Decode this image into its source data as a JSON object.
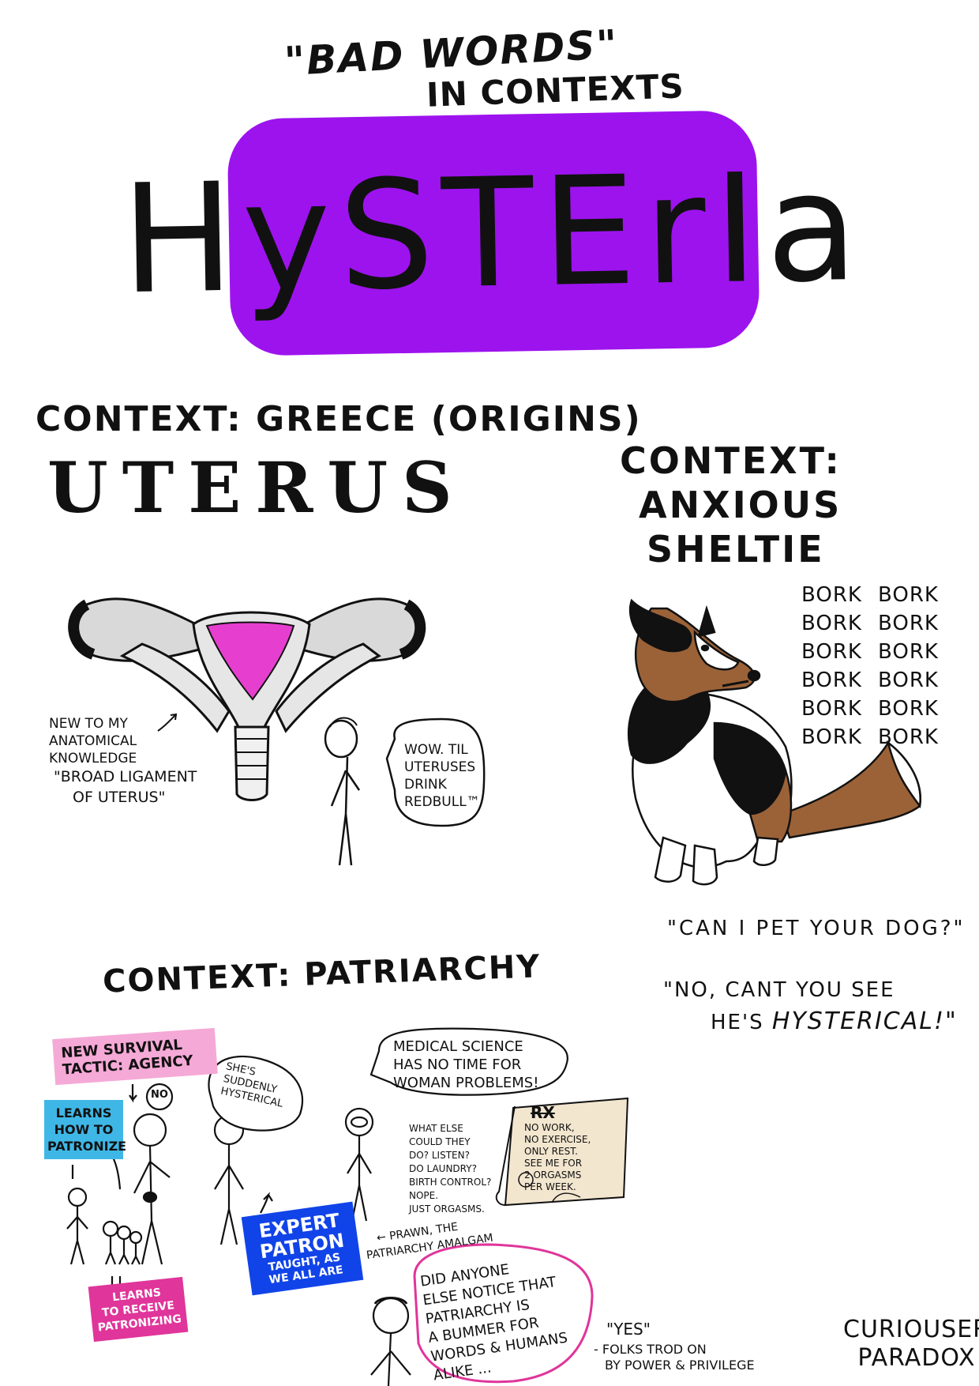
{
  "header": {
    "title_line1": "\"BAD WORDS\"",
    "title_line2": "IN CONTEXTS",
    "banner_word": "HySTErIa",
    "banner_color": "#9d13ee"
  },
  "greece": {
    "heading": "CONTEXT: GREECE (ORIGINS)",
    "word": "UTERUS",
    "note_new_knowledge": [
      "NEW TO MY",
      "ANATOMICAL",
      "KNOWLEDGE"
    ],
    "note_ligament": [
      "\"BROAD LIGAMENT",
      "OF UTERUS\""
    ],
    "speech": [
      "WOW. TIL",
      "UTERUSES",
      "DRINK",
      "REDBULL™"
    ],
    "uterus_color": "#e63fcf"
  },
  "sheltie": {
    "heading": [
      "CONTEXT:",
      "ANXIOUS",
      "SHELTIE"
    ],
    "bork_rows": [
      [
        "BORK",
        "BORK"
      ],
      [
        "BORK",
        "BORK"
      ],
      [
        "BORK",
        "BORK"
      ],
      [
        "BORK",
        "BORK"
      ],
      [
        "BORK",
        "BORK"
      ],
      [
        "BORK",
        "BORK"
      ]
    ],
    "quote_question": "\"CAN I PET YOUR DOG?\"",
    "quote_answer_1": "\"NO, CANT YOU SEE",
    "quote_answer_2_prefix": "HE'S",
    "quote_answer_2_emph": "HYSTERICAL!\""
  },
  "patriarchy": {
    "heading": "CONTEXT: PATRIARCHY",
    "tag_agency": [
      "NEW SURVIVAL",
      "TACTIC: AGENCY"
    ],
    "no_bubble": "NO",
    "tag_learns": [
      "LEARNS",
      "HOW TO",
      "PATRONIZE"
    ],
    "speech_hysterical": [
      "SHE'S",
      "SUDDENLY",
      "HYSTERICAL"
    ],
    "tag_expert": [
      "EXPERT",
      "PATRON"
    ],
    "tag_expert_small": [
      "TAUGHT, AS",
      "WE ALL ARE"
    ],
    "tag_receive": [
      "LEARNS",
      "TO RECEIVE",
      "PATRONIZING"
    ],
    "speech_medical": [
      "MEDICAL SCIENCE",
      "HAS NO TIME FOR",
      "WOMAN PROBLEMS!"
    ],
    "notes_what_else": [
      "WHAT ELSE",
      "COULD THEY",
      "DO? LISTEN?",
      "DO LAUNDRY?",
      "BIRTH CONTROL?",
      "NOPE.",
      "JUST ORGASMS."
    ],
    "rx_title": "RX",
    "rx_lines": [
      "NO WORK,",
      "NO EXERCISE,",
      "ONLY REST.",
      "SEE ME FOR",
      "2 ORGASMS",
      "PER WEEK."
    ],
    "prawn_caption": [
      "← PRAWN, THE",
      "PATRIARCHY AMALGAM"
    ],
    "speech_bummer": [
      "DID ANYONE",
      "ELSE NOTICE THAT",
      "PATRIARCHY IS",
      "A BUMMER FOR",
      "WORDS & HUMANS",
      "ALIKE ..."
    ],
    "quote_yes": "\"YES\"",
    "quote_attrib": [
      "- FOLKS TROD ON",
      "BY POWER & PRIVILEGE"
    ],
    "colors": {
      "pink": "#f5a9d6",
      "blue": "#3fb7e6",
      "royal": "#1144e8",
      "magenta": "#e0359a",
      "parchment": "#f3e6cf"
    }
  },
  "signature": [
    "CURIOUSER",
    "PARADOX"
  ]
}
